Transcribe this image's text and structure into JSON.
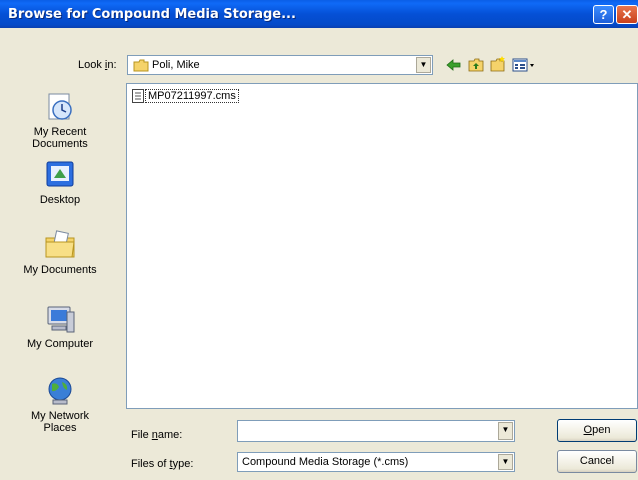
{
  "window": {
    "title": "Browse for Compound Media Storage...",
    "help_label": "?",
    "close_label": "✕"
  },
  "look_in": {
    "label_pre": "Look ",
    "label_key": "i",
    "label_post": "n:",
    "value": "Poli, Mike"
  },
  "places": [
    {
      "label": "My Recent\nDocuments",
      "icon": "recent-documents-icon"
    },
    {
      "label": "Desktop",
      "icon": "desktop-icon"
    },
    {
      "label": "My Documents",
      "icon": "my-documents-icon"
    },
    {
      "label": "My Computer",
      "icon": "my-computer-icon"
    },
    {
      "label": "My Network\nPlaces",
      "icon": "network-places-icon"
    }
  ],
  "files": [
    {
      "name": "MP07211997.cms"
    }
  ],
  "file_name": {
    "label_pre": "File ",
    "label_key": "n",
    "label_post": "ame:",
    "value": ""
  },
  "file_type": {
    "label_pre": "Files of ",
    "label_key": "t",
    "label_post": "ype:",
    "value": "Compound Media Storage (*.cms)"
  },
  "buttons": {
    "open_key": "O",
    "open_rest": "pen",
    "cancel": "Cancel"
  },
  "colors": {
    "titlebar": "#0550d6",
    "dialog_bg": "#ece9d8",
    "field_border": "#7f9db9"
  }
}
